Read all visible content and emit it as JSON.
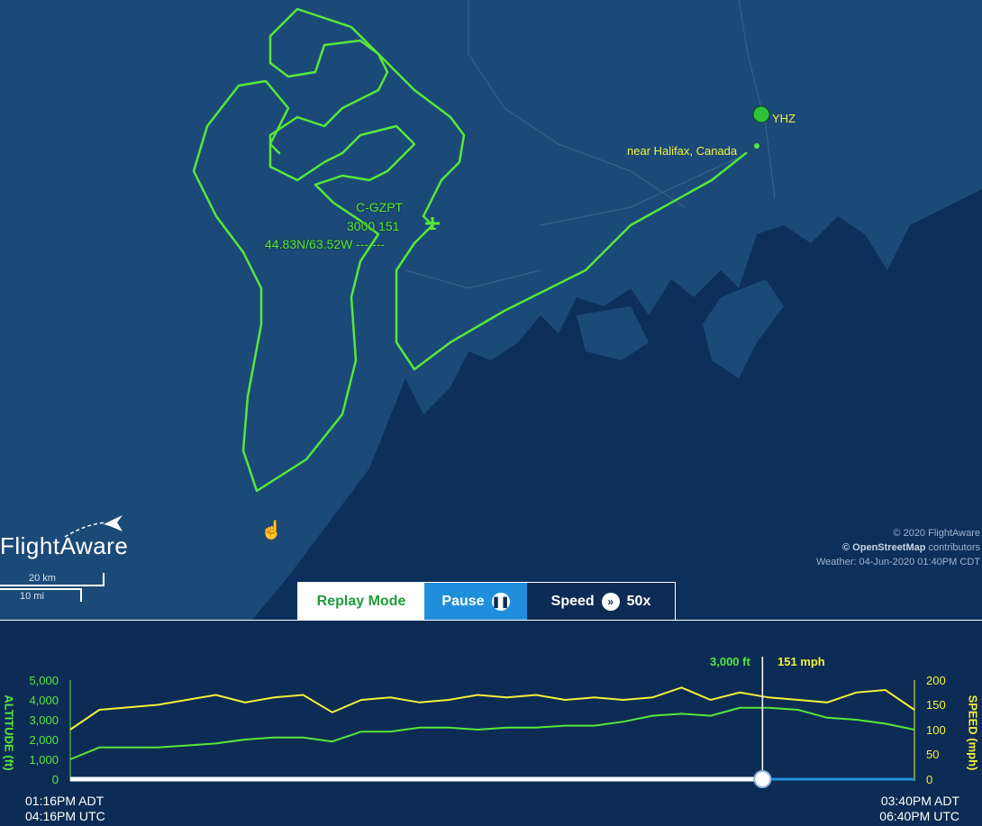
{
  "map": {
    "flight": {
      "callsign": "C-GZPT",
      "alt_speed": "3000 151",
      "position": "44.83N/63.52W --- ---"
    },
    "airport": {
      "code": "YHZ",
      "place": "near Halifax, Canada"
    },
    "credits": {
      "line1": "© 2020 FlightAware",
      "line2_brand": "© OpenStreetMap",
      "line2_rest": " contributors",
      "line3": "Weather: 04-Jun-2020 01:40PM CDT"
    },
    "logo": "FlightAware",
    "scale": {
      "km": "20 km",
      "mi": "10 mi"
    },
    "colors": {
      "water": "#0d2f5c",
      "land": "#1c4a78",
      "track": "#56e83a",
      "label": "#f5f03a"
    }
  },
  "controls": {
    "replay": "Replay Mode",
    "pause": "Pause",
    "speed_label": "Speed",
    "speed_value": "50x"
  },
  "readout": {
    "altitude": "3,000 ft",
    "speed": "151 mph"
  },
  "chart": {
    "left_axis_title": "ALTITUDE (ft)",
    "right_axis_title": "SPEED (mph)",
    "left_ticks": [
      "5,000",
      "4,000",
      "3,000",
      "2,000",
      "1,000",
      "0"
    ],
    "right_ticks": [
      "200",
      "150",
      "100",
      "50",
      "0"
    ],
    "start_time": {
      "local": "01:16PM ADT",
      "utc": "04:16PM UTC"
    },
    "end_time": {
      "local": "03:40PM ADT",
      "utc": "06:40PM UTC"
    },
    "progress": 0.82
  },
  "chart_data": {
    "type": "line",
    "x_label": "time",
    "left_axis": {
      "title": "ALTITUDE (ft)",
      "ylim": [
        0,
        5000
      ]
    },
    "right_axis": {
      "title": "SPEED (mph)",
      "ylim": [
        0,
        200
      ]
    },
    "x": [
      "01:16PM",
      "01:21PM",
      "01:26PM",
      "01:31PM",
      "01:36PM",
      "01:41PM",
      "01:46PM",
      "01:51PM",
      "01:56PM",
      "02:01PM",
      "02:06PM",
      "02:11PM",
      "02:16PM",
      "02:21PM",
      "02:26PM",
      "02:31PM",
      "02:36PM",
      "02:41PM",
      "02:46PM",
      "02:51PM",
      "02:56PM",
      "03:01PM",
      "03:06PM",
      "03:11PM",
      "03:16PM",
      "03:21PM",
      "03:26PM",
      "03:31PM",
      "03:36PM",
      "03:40PM"
    ],
    "series": [
      {
        "axis": "left",
        "color": "#56e83a",
        "values": [
          1000,
          1600,
          1600,
          1600,
          1700,
          1800,
          2000,
          2100,
          2100,
          1900,
          2400,
          2400,
          2600,
          2600,
          2500,
          2600,
          2600,
          2700,
          2700,
          2900,
          3200,
          3300,
          3200,
          3600,
          3600,
          3500,
          3100,
          3000,
          2800,
          2500
        ]
      },
      {
        "axis": "right",
        "color": "#f5f03a",
        "values": [
          100,
          140,
          145,
          150,
          160,
          170,
          155,
          165,
          170,
          135,
          160,
          165,
          155,
          160,
          170,
          165,
          170,
          160,
          165,
          160,
          165,
          185,
          160,
          175,
          165,
          160,
          155,
          175,
          180,
          140
        ]
      }
    ]
  }
}
